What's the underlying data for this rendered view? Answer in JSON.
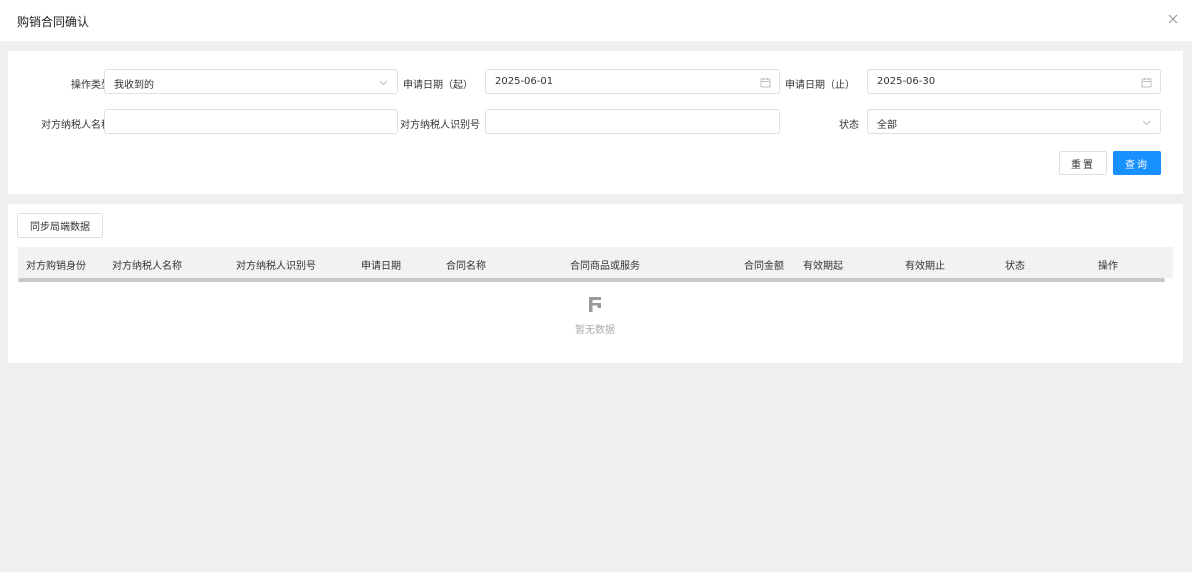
{
  "dialog": {
    "title": "购销合同确认"
  },
  "filters": {
    "operation_type": {
      "label": "操作类型",
      "value": "我收到的"
    },
    "apply_date_start": {
      "label": "申请日期（起）",
      "value": "2025-06-01"
    },
    "apply_date_end": {
      "label": "申请日期（止）",
      "value": "2025-06-30"
    },
    "counterparty_name": {
      "label": "对方纳税人名称",
      "value": ""
    },
    "counterparty_id": {
      "label": "对方纳税人识别号",
      "value": ""
    },
    "status": {
      "label": "状态",
      "value": "全部"
    },
    "reset_label": "重置",
    "query_label": "查询"
  },
  "toolbar": {
    "sync_label": "同步局端数据"
  },
  "table": {
    "columns": [
      "对方购销身份",
      "对方纳税人名称",
      "对方纳税人识别号",
      "申请日期",
      "合同名称",
      "合同商品或服务",
      "合同金额",
      "有效期起",
      "有效期止",
      "状态",
      "操作"
    ],
    "rows": [],
    "empty_text": "暂无数据"
  },
  "icons": {
    "close": "close-icon",
    "dropdown": "chevron-down-icon",
    "calendar": "calendar-icon",
    "empty": "empty-data-icon"
  },
  "colors": {
    "primary": "#1890ff",
    "page_bg": "#efefef"
  }
}
